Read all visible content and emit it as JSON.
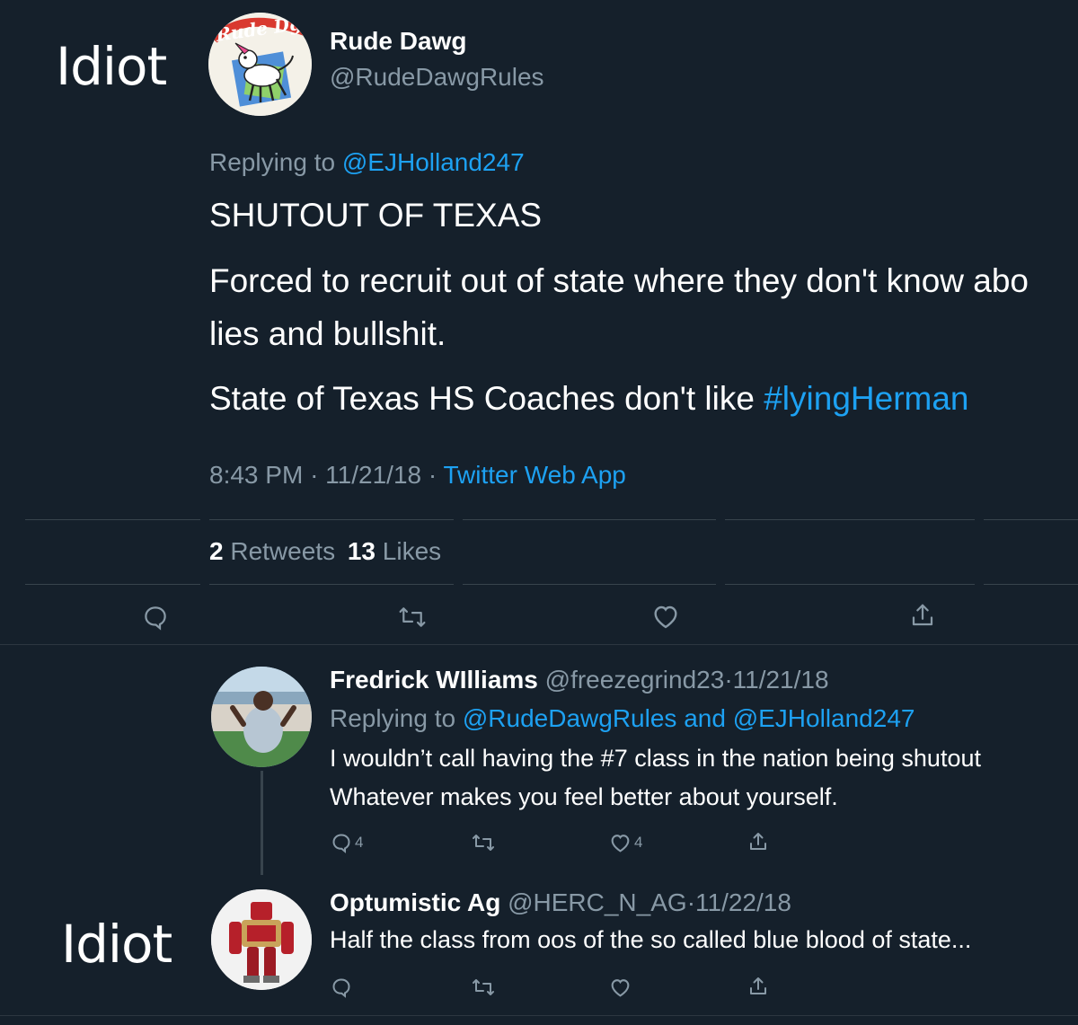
{
  "annotations": {
    "top_label": "Idiot",
    "bottom_label": "Idiot"
  },
  "main_tweet": {
    "display_name": "Rude Dawg",
    "handle": "@RudeDawgRules",
    "avatar_icon": "rude-dawg-cartoon-dog-avatar",
    "avatar_text": "Rude Dg",
    "replying_prefix": "Replying to",
    "replying_to": "@EJHolland247",
    "text_line1": "SHUTOUT OF TEXAS",
    "text_line2": "Forced to recruit out of state where they don't know abo",
    "text_line3": "lies and bullshit.",
    "text_line4_prefix": "State of Texas HS Coaches don't like",
    "hashtag": "#lyingHerman",
    "time": "8:43 PM",
    "date": "11/21/18",
    "source": "Twitter Web App",
    "retweet_count": "2",
    "retweets_label": "Retweets",
    "like_count": "13",
    "likes_label": "Likes",
    "actions": [
      "reply-icon",
      "retweet-icon",
      "like-icon",
      "share-icon"
    ]
  },
  "replies": [
    {
      "display_name": "Fredrick WIlliams",
      "handle": "@freezegrind23",
      "date": "11/21/18",
      "replying_prefix": "Replying to",
      "replying_to_1": "@RudeDawgRules",
      "replying_and": "and",
      "replying_to_2": "@EJHolland247",
      "text_line1": "I wouldn’t call having the #7 class in the nation being shutout",
      "text_line2": "Whatever makes you feel better about yourself.",
      "reply_count": "4",
      "like_count": "4"
    },
    {
      "display_name": "Optumistic Ag",
      "handle": "@HERC_N_AG",
      "date": "11/22/18",
      "text_line1": "Half the class from oos of the so called blue blood of state..."
    }
  ],
  "colors": {
    "background": "#15202b",
    "text": "#ffffff",
    "muted": "#8899a6",
    "link": "#1da1f2",
    "divider": "#38444d"
  }
}
